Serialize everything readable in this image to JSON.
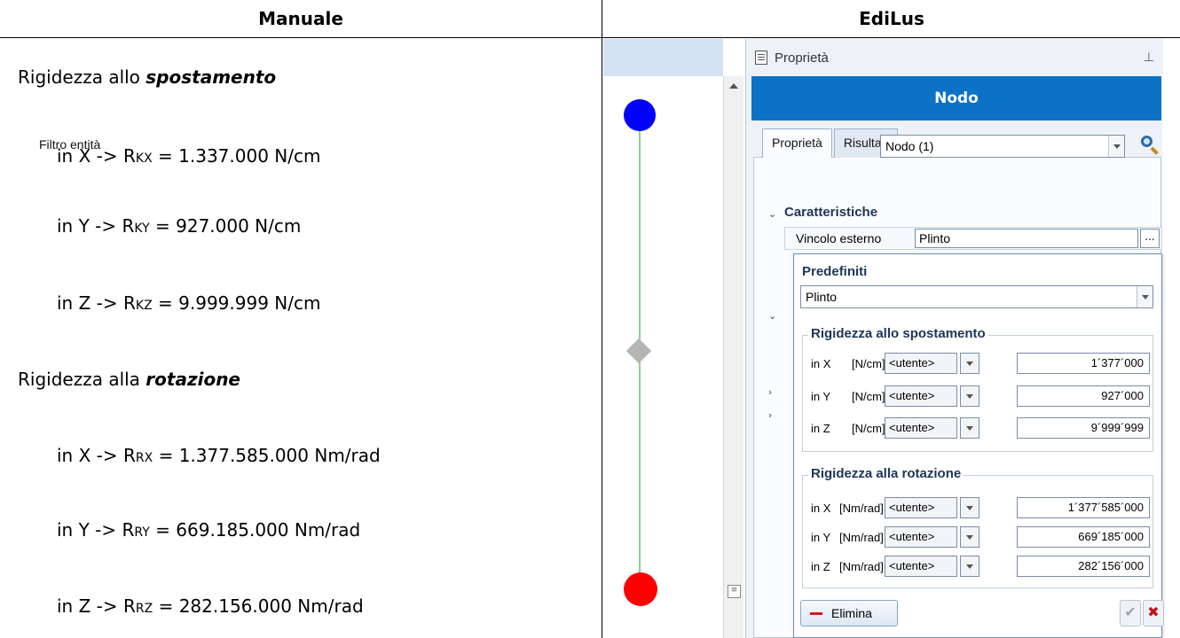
{
  "headers": {
    "left": "Manuale",
    "right": "EdiLus"
  },
  "manuale": {
    "spost_prefix": "Rigidezza allo ",
    "spost_word": "spostamento",
    "rot_prefix": "Rigidezza alla ",
    "rot_word": "rotazione",
    "lines": [
      {
        "pre": "in X -> R",
        "sub": "KX",
        "post": " = 1.337.000 N/cm"
      },
      {
        "pre": "in Y -> R",
        "sub": "KY",
        "post": " = 927.000 N/cm"
      },
      {
        "pre": "in Z -> R",
        "sub": "KZ",
        "post": " = 9.999.999 N/cm"
      },
      {
        "pre": "in X -> R",
        "sub": "RX",
        "post": " = 1.377.585.000 Nm/rad"
      },
      {
        "pre": "in Y -> R",
        "sub": "RY",
        "post": " = 669.185.000 Nm/rad"
      },
      {
        "pre": "in Z -> R",
        "sub": "RZ",
        "post": " = 282.156.000 Nm/rad"
      }
    ]
  },
  "panel": {
    "title": "Proprietà",
    "header": "Nodo",
    "tabs": [
      "Proprietà",
      "Risultati"
    ],
    "filter_label": "Filtro entità",
    "filter_value": "Nodo (1)",
    "section": "Caratteristiche",
    "prop_label": "Vincolo esterno",
    "prop_value": "Plinto",
    "dots": "...",
    "popup": {
      "predef_label": "Predefiniti",
      "predef_value": "Plinto",
      "spost_title": "Rigidezza allo spostamento",
      "rot_title": "Rigidezza alla rotazione",
      "spost_rows": [
        {
          "axis": "in X",
          "unit": "[N/cm]",
          "mode": "<utente>",
          "value": "1´377´000"
        },
        {
          "axis": "in Y",
          "unit": "[N/cm]",
          "mode": "<utente>",
          "value": "927´000"
        },
        {
          "axis": "in Z",
          "unit": "[N/cm]",
          "mode": "<utente>",
          "value": "9´999´999"
        }
      ],
      "rot_rows": [
        {
          "axis": "in X",
          "unit": "[Nm/rad]",
          "mode": "<utente>",
          "value": "1´377´585´000"
        },
        {
          "axis": "in Y",
          "unit": "[Nm/rad]",
          "mode": "<utente>",
          "value": "669´185´000"
        },
        {
          "axis": "in Z",
          "unit": "[Nm/rad]",
          "mode": "<utente>",
          "value": "282´156´000"
        }
      ],
      "delete_label": "Elimina",
      "ok_glyph": "✔",
      "cancel_glyph": "✖"
    }
  }
}
